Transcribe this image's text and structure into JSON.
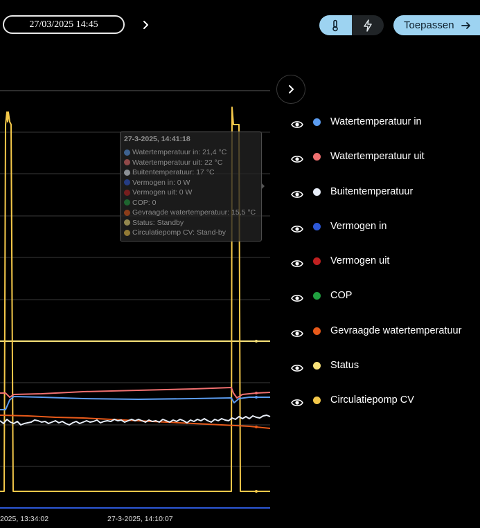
{
  "toolbar": {
    "datetime_value": "27/03/2025 14:45",
    "next_icon": "chevron-right-icon",
    "toggle_temperature_icon": "thermometer-icon",
    "toggle_power_icon": "lightning-icon",
    "apply_label": "Toepassen",
    "apply_icon": "arrow-right-icon"
  },
  "legend": {
    "toggle_icon": "chevron-right-icon",
    "items": [
      {
        "label": "Watertemperatuur in",
        "color": "#5b9cf0"
      },
      {
        "label": "Watertemperatuur uit",
        "color": "#f07070"
      },
      {
        "label": "Buitentemperatuur",
        "color": "#e8eef8"
      },
      {
        "label": "Vermogen in",
        "color": "#2d58d8"
      },
      {
        "label": "Vermogen uit",
        "color": "#c02020"
      },
      {
        "label": "COP",
        "color": "#20a040"
      },
      {
        "label": "Gevraagde watertemperatuur",
        "color": "#e85a1a"
      },
      {
        "label": "Status",
        "color": "#f8e27a"
      },
      {
        "label": "Circulatiepomp CV",
        "color": "#f4c84a"
      }
    ]
  },
  "tooltip": {
    "title": "27-3-2025, 14:41:18",
    "rows": [
      {
        "text": "Watertemperatuur in: 21,4 °C",
        "color": "#5b9cf0"
      },
      {
        "text": "Watertemperatuur uit: 22 °C",
        "color": "#f07070"
      },
      {
        "text": "Buitentemperatuur: 17 °C",
        "color": "#e8eef8"
      },
      {
        "text": "Vermogen in: 0 W",
        "color": "#2d58d8"
      },
      {
        "text": "Vermogen uit: 0 W",
        "color": "#c02020"
      },
      {
        "text": "COP: 0",
        "color": "#20a040"
      },
      {
        "text": "Gevraagde watertemperatuur: 15,5 °C",
        "color": "#e85a1a"
      },
      {
        "text": "Status: Standby",
        "color": "#f8e27a"
      },
      {
        "text": "Circulatiepomp CV: Stand-by",
        "color": "#f4c84a"
      }
    ]
  },
  "chart_data": {
    "type": "line",
    "x_tick_labels": [
      "2025, 13:34:02",
      "27-3-2025, 14:10:07"
    ],
    "series": [
      {
        "name": "Watertemperatuur in",
        "color": "#5b9cf0"
      },
      {
        "name": "Watertemperatuur uit",
        "color": "#f07070"
      },
      {
        "name": "Buitentemperatuur",
        "color": "#e8eef8"
      },
      {
        "name": "Vermogen in",
        "color": "#2d58d8"
      },
      {
        "name": "Gevraagde watertemperatuur",
        "color": "#e85a1a"
      },
      {
        "name": "Status",
        "color": "#f8e27a"
      },
      {
        "name": "Circulatiepomp CV",
        "color": "#f4c84a"
      }
    ]
  }
}
